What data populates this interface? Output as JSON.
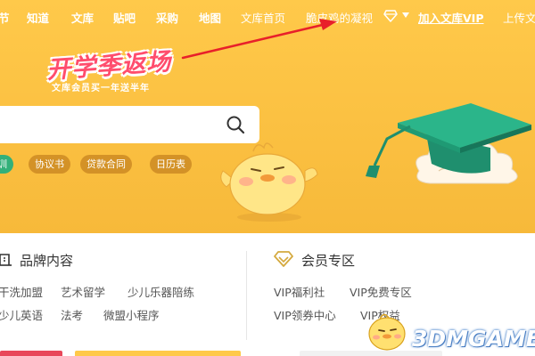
{
  "nav": {
    "items": [
      {
        "label": "节",
        "bold": true
      },
      {
        "label": "知道",
        "bold": true
      },
      {
        "label": "文库",
        "bold": true
      },
      {
        "label": "贴吧",
        "bold": true
      },
      {
        "label": "采购",
        "bold": true
      },
      {
        "label": "地图",
        "bold": true
      },
      {
        "label": "文库首页",
        "bold": false
      },
      {
        "label": "脆皮鸡的凝视",
        "bold": false
      }
    ],
    "join_vip": "加入文库VIP",
    "upload": "上传文"
  },
  "promo": {
    "title": "开学季返场",
    "subtitle": "文库会员买一年送半年"
  },
  "search": {
    "value": "",
    "placeholder": ""
  },
  "tags": [
    "训",
    "协议书",
    "贷款合同",
    "日历表"
  ],
  "brand_section": {
    "title": "品牌内容",
    "links_row1": [
      "干洗加盟",
      "艺术留学",
      "少儿乐器陪练"
    ],
    "links_row2": [
      "少儿英语",
      "法考",
      "微盟小程序"
    ]
  },
  "vip_section": {
    "title": "会员专区",
    "links_row1": [
      "VIP福利社",
      "VIP免费专区"
    ],
    "links_row2": [
      "VIP领券中心",
      "VIP权益"
    ]
  },
  "watermark": "3DMGAME",
  "colors": {
    "hero_bg": "#ffc94a",
    "promo_pink": "#ff4d6d",
    "tag_green": "#33b07a",
    "arrow_red": "#e8202a"
  }
}
